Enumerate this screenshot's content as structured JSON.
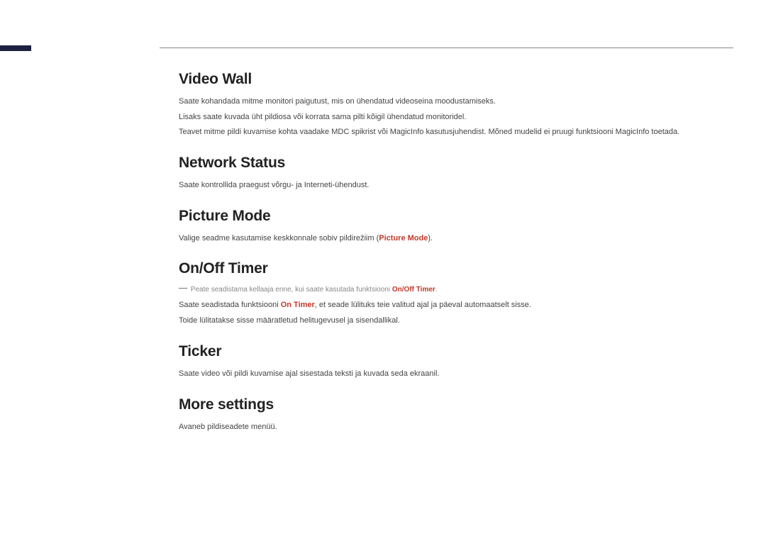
{
  "sections": {
    "video_wall": {
      "heading": "Video Wall",
      "p1": "Saate kohandada mitme monitori paigutust, mis on ühendatud videoseina moodustamiseks.",
      "p2": "Lisaks saate kuvada üht pildiosa või korrata sama pilti kõigil ühendatud monitoridel.",
      "p3": "Teavet mitme pildi kuvamise kohta vaadake MDC spikrist või MagicInfo kasutusjuhendist. Mõned mudelid ei pruugi funktsiooni MagicInfo toetada."
    },
    "network_status": {
      "heading": "Network Status",
      "p1": "Saate kontrollida praegust võrgu- ja Interneti-ühendust."
    },
    "picture_mode": {
      "heading": "Picture Mode",
      "p1_pre": "Valige seadme kasutamise keskkonnale sobiv pildirežiim (",
      "p1_hl": "Picture Mode",
      "p1_post": ")."
    },
    "onoff_timer": {
      "heading": "On/Off Timer",
      "note_pre": "Peate seadistama kellaaja enne, kui saate kasutada funktsiooni ",
      "note_hl": "On/Off Timer",
      "note_post": ".",
      "p1_pre": "Saate seadistada funktsiooni ",
      "p1_hl": "On Timer",
      "p1_post": ", et seade lülituks teie valitud ajal ja päeval automaatselt sisse.",
      "p2": "Toide lülitatakse sisse määratletud helitugevusel ja sisendallikal."
    },
    "ticker": {
      "heading": "Ticker",
      "p1": "Saate video või pildi kuvamise ajal sisestada teksti ja kuvada seda ekraanil."
    },
    "more_settings": {
      "heading": "More settings",
      "p1": "Avaneb pildiseadete menüü."
    }
  }
}
